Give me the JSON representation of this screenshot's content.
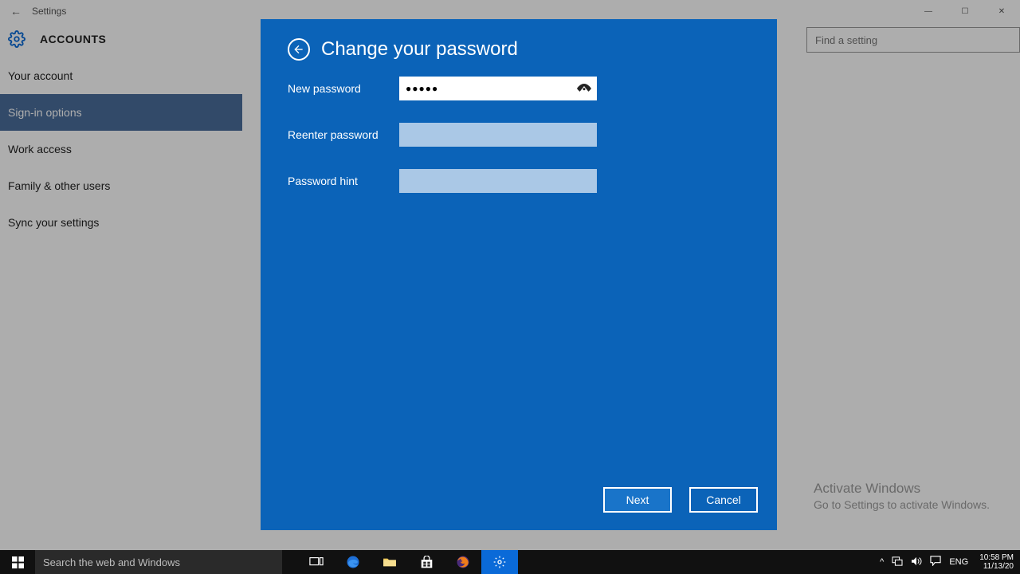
{
  "window": {
    "title": "Settings",
    "section_title": "ACCOUNTS",
    "search_placeholder": "Find a setting"
  },
  "sidebar": {
    "items": [
      {
        "label": "Your account",
        "active": false
      },
      {
        "label": "Sign-in options",
        "active": true
      },
      {
        "label": "Work access",
        "active": false
      },
      {
        "label": "Family & other users",
        "active": false
      },
      {
        "label": "Sync your settings",
        "active": false
      }
    ]
  },
  "modal": {
    "title": "Change your password",
    "fields": {
      "new_password": {
        "label": "New password",
        "value": "●●●●●"
      },
      "reenter_password": {
        "label": "Reenter password",
        "value": ""
      },
      "password_hint": {
        "label": "Password hint",
        "value": ""
      }
    },
    "buttons": {
      "next": "Next",
      "cancel": "Cancel"
    }
  },
  "activation": {
    "line1": "Activate Windows",
    "line2": "Go to Settings to activate Windows."
  },
  "taskbar": {
    "search_placeholder": "Search the web and Windows",
    "lang": "ENG",
    "time": "10:58 PM",
    "date": "11/13/20"
  }
}
